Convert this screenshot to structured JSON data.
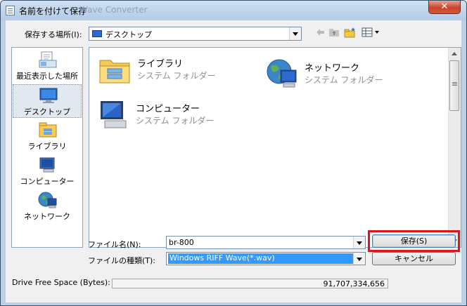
{
  "window": {
    "title": "名前を付けて保存",
    "title_ghost": "Wave Converter",
    "close_label": "✕"
  },
  "location": {
    "label": "保存する場所(I):",
    "value": "デスクトップ"
  },
  "places": [
    {
      "label": "最近表示した場所",
      "icon": "recent-places-icon"
    },
    {
      "label": "デスクトップ",
      "icon": "desktop-icon",
      "selected": true
    },
    {
      "label": "ライブラリ",
      "icon": "libraries-icon"
    },
    {
      "label": "コンピューター",
      "icon": "computer-icon"
    },
    {
      "label": "ネットワーク",
      "icon": "network-icon"
    }
  ],
  "files": [
    {
      "name": "ライブラリ",
      "type": "システム フォルダー",
      "icon": "libraries-folder-icon"
    },
    {
      "name": "ネットワーク",
      "type": "システム フォルダー",
      "icon": "network-globe-icon"
    },
    {
      "name": "コンピューター",
      "type": "システム フォルダー",
      "icon": "computer-icon"
    }
  ],
  "filename": {
    "label": "ファイル名(N):",
    "value": "br-800"
  },
  "filetype": {
    "label": "ファイルの種類(T):",
    "value": "Windows RIFF Wave(*.wav)"
  },
  "buttons": {
    "save": "保存(S)",
    "cancel": "キャンセル"
  },
  "free_space": {
    "label": "Drive Free Space (Bytes):",
    "value": "91,707,334,656"
  },
  "colors": {
    "highlight_frame": "#e0121a",
    "selection": "#3399ff"
  }
}
